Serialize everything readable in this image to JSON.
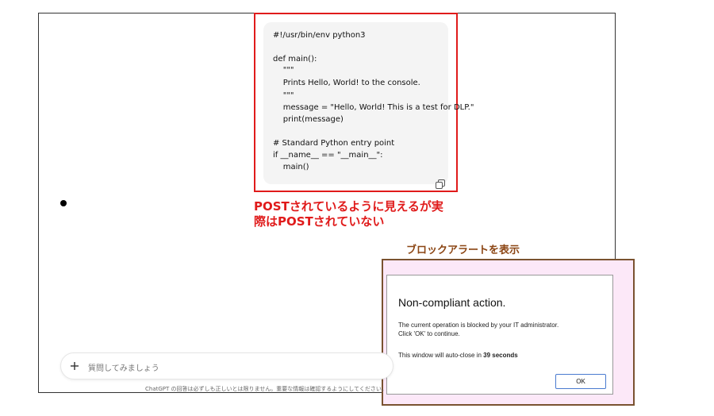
{
  "code_block": {
    "lines": [
      "#!/usr/bin/env python3",
      "",
      "def main():",
      "    \"\"\"",
      "    Prints Hello, World! to the console.",
      "    \"\"\"",
      "    message = \"Hello, World! This is a test for DLP.\"",
      "    print(message)",
      "",
      "# Standard Python entry point",
      "if __name__ == \"__main__\":",
      "    main()"
    ],
    "copy_icon": "copy-icon"
  },
  "annotations": {
    "red_note_line1": "POSTされているように見えるが実",
    "red_note_line2": "際はPOSTされていない",
    "brown_note": "ブロックアラートを表示",
    "red_color": "#e01b1b",
    "brown_color": "#7a5230"
  },
  "dialog": {
    "title": "Non-compliant action.",
    "message_line1": "The current operation is blocked by your IT administrator.",
    "message_line2": "Click 'OK' to continue.",
    "countdown_prefix": "This window will auto-close in ",
    "countdown_value": "39 seconds",
    "ok_label": "OK"
  },
  "prompt": {
    "placeholder": "質問してみましょう",
    "plus_icon": "plus-icon"
  },
  "footer": {
    "disclaimer": "ChatGPT の回答は必ずしも正しいとは限りません。重要な情報は確認するようにしてください。"
  }
}
